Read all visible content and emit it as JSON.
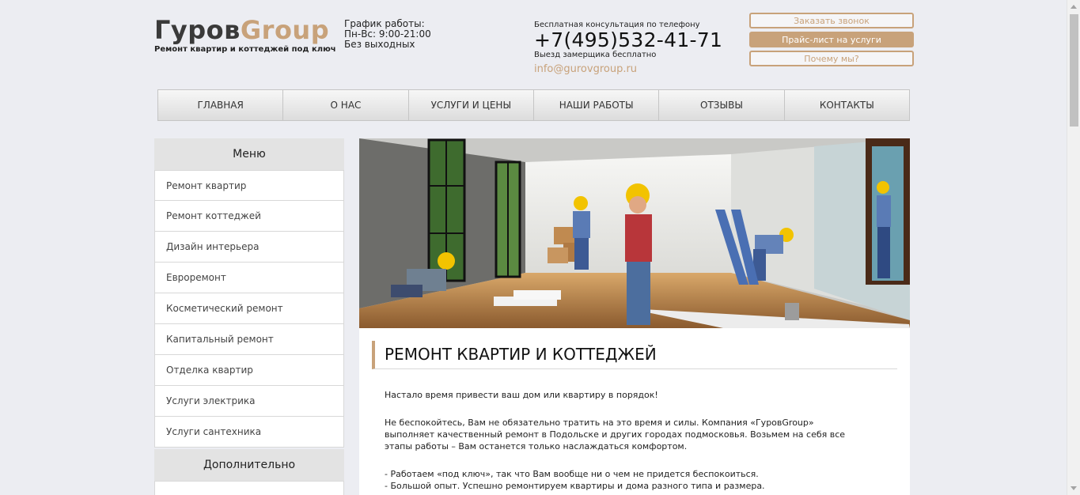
{
  "header": {
    "logo_part1": "Гуров",
    "logo_part2": "Group",
    "tagline": "Ремонт квартир и коттеджей под ключ",
    "hours_title": "График работы:",
    "hours_days": "Пн-Вс: 9:00-21:00",
    "hours_weekend": "Без выходных",
    "consult_label": "Бесплатная консультация по телефону",
    "phone": "+7(495)532-41-71",
    "measurer": "Выезд замерщика бесплатно",
    "email": "info@gurovgroup.ru",
    "buttons": {
      "callback": "Заказать звонок",
      "pricelist": "Прайс-лист на услуги",
      "why": "Почему мы?"
    }
  },
  "nav": {
    "items": [
      "ГЛАВНАЯ",
      "О НАС",
      "УСЛУГИ И ЦЕНЫ",
      "НАШИ РАБОТЫ",
      "ОТЗЫВЫ",
      "КОНТАКТЫ"
    ]
  },
  "sidebar": {
    "menu_title": "Меню",
    "items": [
      "Ремонт квартир",
      "Ремонт коттеджей",
      "Дизайн интерьера",
      "Евроремонт",
      "Косметический ремонт",
      "Капитальный ремонт",
      "Отделка квартир",
      "Услуги электрика",
      "Услуги сантехника"
    ],
    "extra_title": "Дополнительно"
  },
  "content": {
    "title": "РЕМОНТ КВАРТИР И КОТТЕДЖЕЙ",
    "p1": "Настало время привести ваш дом или квартиру в порядок!",
    "p2": "Не беспокойтесь, Вам не обязательно тратить на это время и силы. Компания «ГуровGroup» выполняет качественный ремонт в Подольске и других городах подмосковья. Возьмем на себя все этапы работы – Вам останется только наслаждаться комфортом.",
    "b1": "- Работаем «под ключ», так что Вам вообще ни о чем не придется беспокоиться.",
    "b2": "- Большой опыт. Успешно ремонтируем квартиры и дома разного типа и размера."
  },
  "colors": {
    "accent": "#c8a27a",
    "background": "#ecedf2"
  }
}
